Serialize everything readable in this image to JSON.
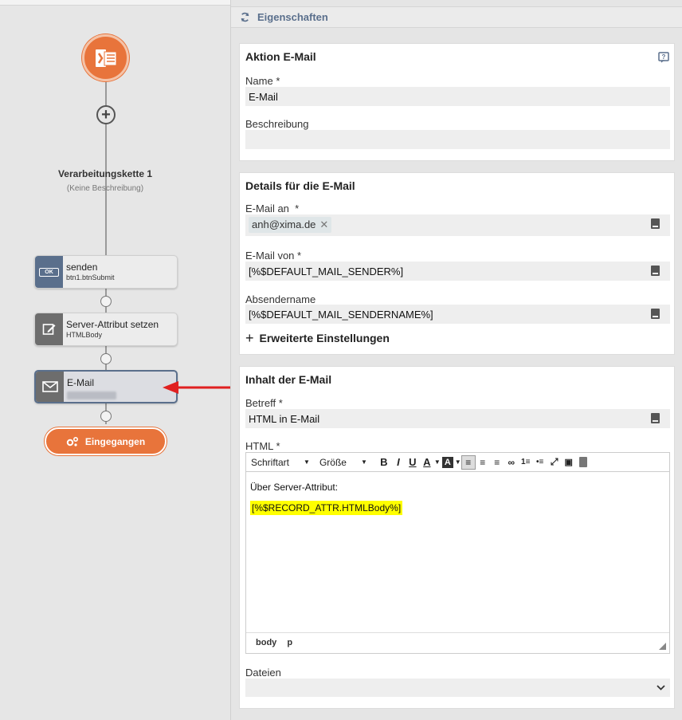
{
  "flow": {
    "chain_title": "Verarbeitungskette 1",
    "chain_description": "(Keine Beschreibung)",
    "nodes": [
      {
        "label": "senden",
        "sub": "btn1.btnSubmit",
        "icon": "ok-button-icon",
        "icon_text": "OK",
        "color": "#5a6f8c"
      },
      {
        "label": "Server-Attribut setzen",
        "sub": "HTMLBody",
        "icon": "edit-icon",
        "color": "#6d6d6d"
      },
      {
        "label": "E-Mail",
        "sub": "",
        "icon": "mail-icon",
        "color": "#6d6d6d"
      }
    ],
    "end_node": {
      "label": "Eingegangen",
      "icon": "gears-icon",
      "color": "#e8743b"
    }
  },
  "panel": {
    "title": "Eigenschaften",
    "action_card": {
      "heading": "Aktion E-Mail",
      "name_label": "Name",
      "required_mark": "*",
      "name_value": "E-Mail",
      "desc_label": "Beschreibung",
      "desc_value": ""
    },
    "details_card": {
      "heading": "Details für die E-Mail",
      "to_label": "E-Mail an",
      "to_chip": "anh@xima.de",
      "from_label": "E-Mail von",
      "from_value": "[%$DEFAULT_MAIL_SENDER%]",
      "sendername_label": "Absendername",
      "sendername_value": "[%$DEFAULT_MAIL_SENDERNAME%]",
      "advanced_label": "Erweiterte Einstellungen"
    },
    "content_card": {
      "heading": "Inhalt der E-Mail",
      "subject_label": "Betreff",
      "subject_value": "HTML in E-Mail",
      "html_label": "HTML",
      "font_select": "Schriftart",
      "size_select": "Größe",
      "body_line1": "Über Server-Attribut:",
      "body_line2": "[%$RECORD_ATTR.HTMLBody%]",
      "status_path": [
        "body",
        "p"
      ],
      "files_label": "Dateien"
    }
  },
  "colors": {
    "accent_orange": "#e8743b",
    "header_blue": "#5a6f8c",
    "highlight": "#ffff00",
    "arrow_red": "#e02020"
  }
}
